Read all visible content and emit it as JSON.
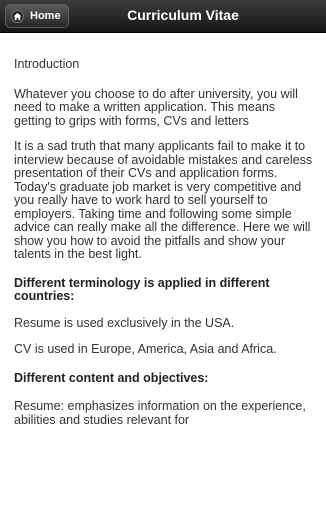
{
  "header": {
    "home_label": "Home",
    "title": "Curriculum Vitae"
  },
  "content": {
    "intro_heading": "Introduction",
    "para1": "Whatever you choose to do after university, you will need to make a written application. This means getting to grips with forms, CVs and letters",
    "para2": "It is a sad truth that many applicants fail to make it to interview because of avoidable mistakes and careless presentation of their CVs and application forms. Today's graduate job market is very competitive and you really have to work hard to sell yourself to employers. Taking time and following some simple advice can really make all the difference. Here we will show you how to avoid the pitfalls and show your talents in the best light.",
    "terminology_heading": "Different terminology is applied in different countries:",
    "resume_usa": "Resume is used exclusively in the USA.",
    "cv_regions": "CV is used in Europe, America, Asia and Africa.",
    "content_heading": "Different content and objectives:",
    "resume_emphasis": "Resume: emphasizes information on the experience, abilities and studies relevant for"
  }
}
